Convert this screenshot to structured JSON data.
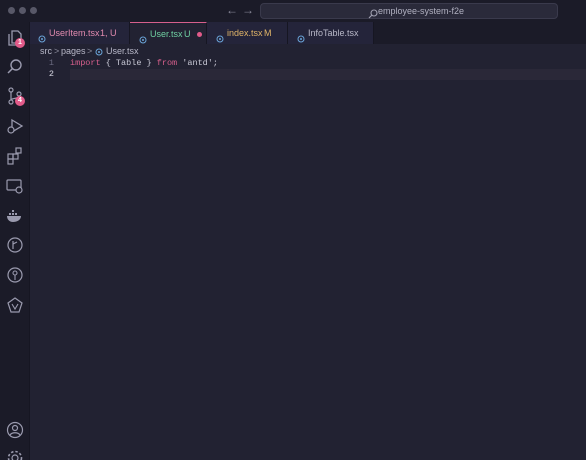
{
  "window": {
    "title": "employee-system-f2e",
    "back_arrow": "←",
    "forward_arrow": "→"
  },
  "colors": {
    "accent": "#d75f8c",
    "badge": "#e25b8a",
    "tab_untracked": "#e38bb0",
    "tab_active_green": "#6fd0a2",
    "tab_modified": "#e0b468"
  },
  "activity_bar": {
    "explorer_badge": "1",
    "source_control_badge": "4",
    "icons": [
      "files-icon",
      "search-icon",
      "source-control-icon",
      "run-debug-icon",
      "extensions-icon",
      "remote-explorer-icon",
      "docker-icon",
      "git-graph-icon",
      "gitlens-icon",
      "deploy-icon",
      "account-icon",
      "settings-gear-icon"
    ]
  },
  "tabs": [
    {
      "label": "UserItem.tsx",
      "status": "1, U"
    },
    {
      "label": "User.tsx",
      "status": "U"
    },
    {
      "label": "index.tsx",
      "status": "M"
    },
    {
      "label": "InfoTable.tsx",
      "status": ""
    }
  ],
  "breadcrumb": {
    "items": [
      "src",
      "pages",
      "User.tsx"
    ],
    "separator": ">"
  },
  "editor": {
    "lines": [
      {
        "number": "1",
        "tokens": {
          "kw1": "import",
          "open": " { ",
          "ident": "Table",
          "close": " } ",
          "kw2": "from",
          "sp": " ",
          "str": "'antd'",
          "semi": ";"
        }
      },
      {
        "number": "2"
      }
    ]
  }
}
